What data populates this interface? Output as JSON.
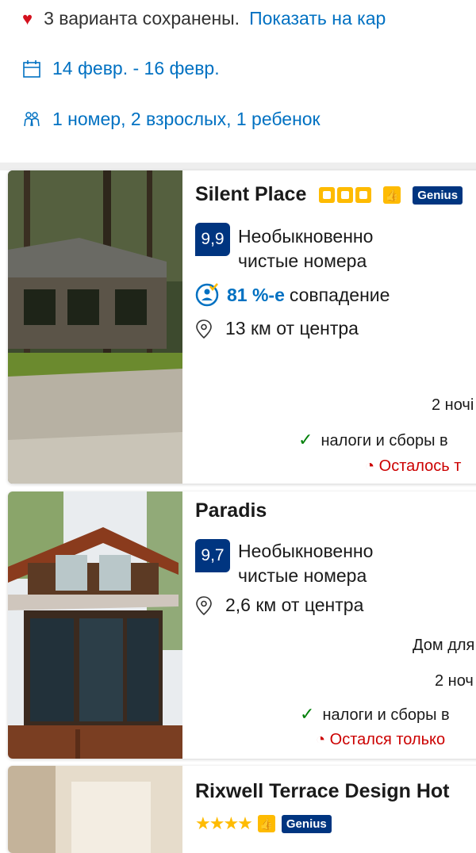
{
  "summary": {
    "saved_text": "3 варианта сохранены.",
    "map_link": "Показать на кар",
    "dates": "14 февр. - 16 февр.",
    "guests": "1 номер, 2 взрослых, 1 ребенок"
  },
  "listings": [
    {
      "name": "Silent Place",
      "stars": 3,
      "badge": "Genius",
      "score": "9,9",
      "score_text_line1": "Необыкновенно",
      "score_text_line2": "чистые номера",
      "match_value": "81 %-е",
      "match_text": "совпадение",
      "distance": "13 км от центра",
      "nights": "2 ночі",
      "taxes": "налоги и сборы в",
      "left": "Осталось т"
    },
    {
      "name": "Paradis",
      "score": "9,7",
      "score_text_line1": "Необыкновенно",
      "score_text_line2": "чистые номера",
      "distance": "2,6 км от центра",
      "room_type": "Дом для",
      "nights": "2 ноч",
      "taxes": "налоги и сборы в",
      "left": "Остался только"
    },
    {
      "name": "Rixwell Terrace Design Hot",
      "stars": 4,
      "badge": "Genius"
    }
  ],
  "colors": {
    "link": "#0071c2",
    "score_bg": "#003580",
    "star": "#febb02",
    "heart": "#d4111e",
    "check": "#008009",
    "urgency": "#cc0000"
  }
}
